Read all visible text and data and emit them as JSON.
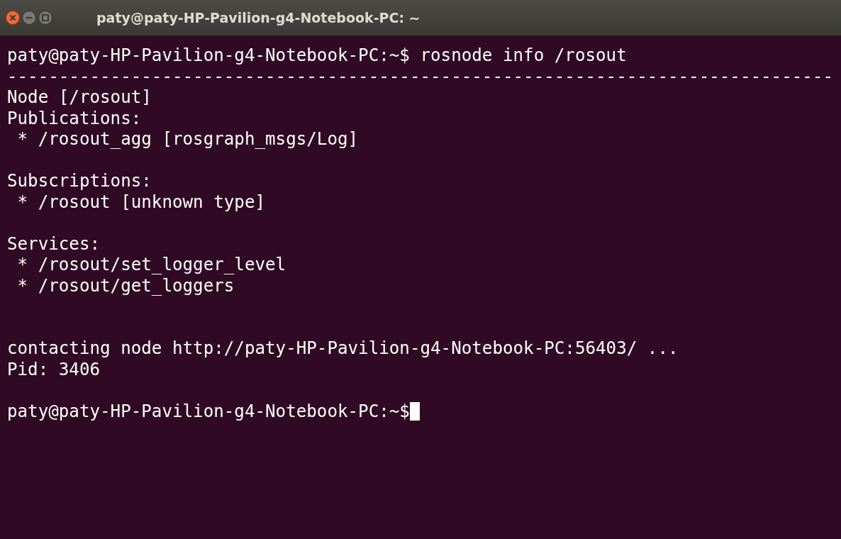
{
  "window": {
    "title": "paty@paty-HP-Pavilion-g4-Notebook-PC: ~"
  },
  "lines": [
    {
      "kind": "text",
      "text": "paty@paty-HP-Pavilion-g4-Notebook-PC:~$ rosnode info /rosout"
    },
    {
      "kind": "text",
      "text": "--------------------------------------------------------------------------------"
    },
    {
      "kind": "text",
      "text": "Node [/rosout]"
    },
    {
      "kind": "text",
      "text": "Publications:"
    },
    {
      "kind": "text",
      "text": " * /rosout_agg [rosgraph_msgs/Log]"
    },
    {
      "kind": "blank"
    },
    {
      "kind": "text",
      "text": "Subscriptions:"
    },
    {
      "kind": "text",
      "text": " * /rosout [unknown type]"
    },
    {
      "kind": "blank"
    },
    {
      "kind": "text",
      "text": "Services:"
    },
    {
      "kind": "text",
      "text": " * /rosout/set_logger_level"
    },
    {
      "kind": "text",
      "text": " * /rosout/get_loggers"
    },
    {
      "kind": "blank"
    },
    {
      "kind": "blank"
    },
    {
      "kind": "text",
      "text": "contacting node http://paty-HP-Pavilion-g4-Notebook-PC:56403/ ..."
    },
    {
      "kind": "text",
      "text": "Pid: 3406"
    },
    {
      "kind": "blank"
    },
    {
      "kind": "prompt",
      "text": "paty@paty-HP-Pavilion-g4-Notebook-PC:~$",
      "cursor": true
    }
  ]
}
